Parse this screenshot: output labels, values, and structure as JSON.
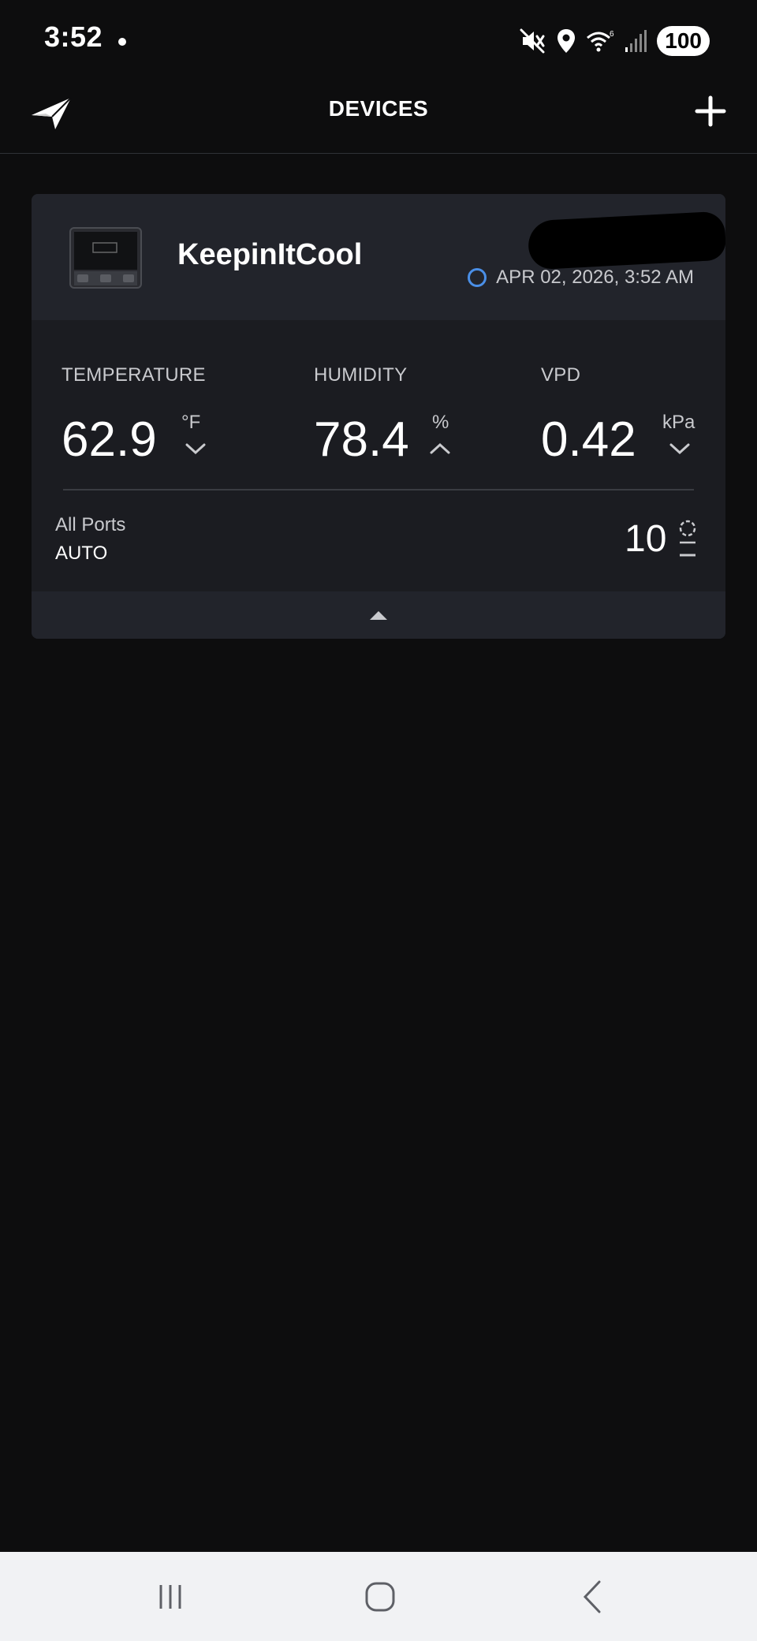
{
  "status_bar": {
    "time": "3:52",
    "battery": "100",
    "icons": [
      "notification-dot-icon",
      "mute-icon",
      "location-icon",
      "wifi-icon",
      "signal-icon",
      "battery-icon"
    ]
  },
  "header": {
    "title": "DEVICES",
    "logo_icon": "paper-plane-logo-icon",
    "add_icon": "plus-icon"
  },
  "device": {
    "name": "KeepinItCool",
    "timestamp": "APR 02, 2026, 3:52 AM",
    "status_color": "#4a8fe7",
    "metrics": [
      {
        "label": "TEMPERATURE",
        "value": "62.9",
        "unit": "°F",
        "trend": "down"
      },
      {
        "label": "HUMIDITY",
        "value": "78.4",
        "unit": "%",
        "trend": "up"
      },
      {
        "label": "VPD",
        "value": "0.42",
        "unit": "kPa",
        "trend": "down"
      }
    ],
    "ports": {
      "label": "All Ports",
      "mode": "AUTO",
      "speed": "10"
    }
  },
  "nav": {
    "icons": [
      "recent-apps-icon",
      "home-icon",
      "back-icon"
    ]
  }
}
